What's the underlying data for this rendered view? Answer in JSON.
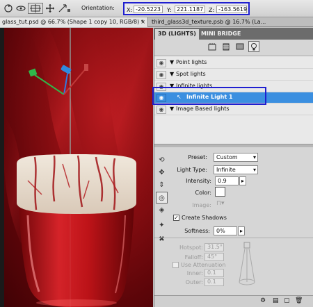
{
  "options_bar": {
    "orientation_label": "Orientation:",
    "x_label": "X:",
    "x_value": "-20.5223",
    "y_label": "Y:",
    "y_value": "221.1187",
    "z_label": "Z:",
    "z_value": "-163.5619",
    "tools": [
      "rotate-3d-icon",
      "roll-3d-icon",
      "drag-3d-icon",
      "slide-3d-icon",
      "scale-3d-icon"
    ]
  },
  "doc_tabs": [
    {
      "label": "glass_tut.psd @ 66.7% (Shape 1 copy 10, RGB/8) *",
      "close": "×"
    },
    {
      "label": "third_glass3d_texture.psb @ 16.7% (La..."
    }
  ],
  "panel": {
    "tabs": [
      "3D (LIGHTS)",
      "MINI BRIDGE"
    ],
    "filter_icons": [
      "whole-scene-icon",
      "meshes-icon",
      "materials-icon",
      "lights-icon"
    ],
    "lights": [
      {
        "label": "Point lights"
      },
      {
        "label": "Spot lights"
      },
      {
        "label": "Infinite lights"
      },
      {
        "label": "Infinite Light 1",
        "selected": true
      },
      {
        "label": "Image Based lights"
      }
    ],
    "properties": {
      "preset_label": "Preset:",
      "preset_value": "Custom",
      "light_type_label": "Light Type:",
      "light_type_value": "Infinite",
      "intensity_label": "Intensity:",
      "intensity_value": "0.9",
      "color_label": "Color:",
      "color_value": "#ffffff",
      "image_label": "Image:",
      "create_shadows_label": "Create Shadows",
      "create_shadows_checked": true,
      "softness_label": "Softness:",
      "softness_value": "0%",
      "hotspot_label": "Hotspot:",
      "hotspot_value": "31.5°",
      "falloff_label": "Falloff:",
      "falloff_value": "45°",
      "use_attenuation_label": "Use Attenuation",
      "inner_label": "Inner:",
      "inner_value": "0.1",
      "outer_label": "Outer:",
      "outer_value": "0.1"
    }
  },
  "colors": {
    "selection_blue": "#3b8fe0",
    "annotation_box": "#1f1fd0",
    "canvas_red": "#8b0e12"
  }
}
